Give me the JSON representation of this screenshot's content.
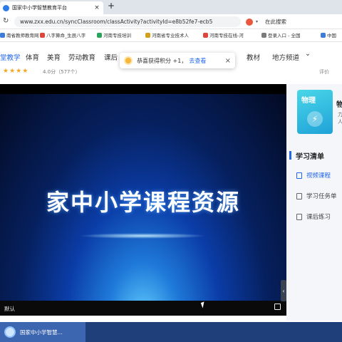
{
  "browser": {
    "tab_title": "国家中小学智慧教育平台",
    "tab_close": "×",
    "new_tab": "+",
    "url": "www.zxx.edu.cn/syncClassroom/classActivity?activityId=e8b52fe7-ecb5",
    "search_label": "在此搜索",
    "back": "‹",
    "forward": "›",
    "reload": "↻"
  },
  "bookmarks": [
    {
      "label": "南省教师教育网",
      "color": "#3b7dd8"
    },
    {
      "label": "八字算命_生辰八字",
      "color": "#e0453a"
    },
    {
      "label": "河南专技培训",
      "color": "#2aa35a"
    },
    {
      "label": "河南省专业技术人",
      "color": "#d4a017"
    },
    {
      "label": "河南专技在线-河",
      "color": "#e0453a"
    },
    {
      "label": "登录入口 - 全国",
      "color": "#7a7a7a"
    },
    {
      "label": "中国",
      "color": "#3b7dd8"
    }
  ],
  "site_nav": {
    "items": [
      {
        "label": "堂教学",
        "active": true
      },
      {
        "label": "体育",
        "active": false
      },
      {
        "label": "美育",
        "active": false
      },
      {
        "label": "劳动教育",
        "active": false
      },
      {
        "label": "课后",
        "active": false
      },
      {
        "label": "教材",
        "active": false
      },
      {
        "label": "地方频道",
        "active": false
      }
    ],
    "dropdown_arrow": "⌄"
  },
  "rating": {
    "stars": "★★★★",
    "score": "4.0分（577个）",
    "rate_button": "评价"
  },
  "toast": {
    "message": "恭喜获得积分 +1，",
    "link": "去查看",
    "close": "×"
  },
  "video": {
    "title_text": "家中小学课程资源",
    "control_label": "默认",
    "side_handle": "‹"
  },
  "right_panel": {
    "subject": "物理",
    "course_title": "物",
    "course_sub": "力\n人",
    "list_heading": "学习清单",
    "items": [
      {
        "label": "视频课程",
        "active": true
      },
      {
        "label": "学习任务单",
        "active": false
      },
      {
        "label": "课后练习",
        "active": false
      }
    ]
  },
  "taskbar": {
    "app_label": "国家中小学智慧..."
  }
}
